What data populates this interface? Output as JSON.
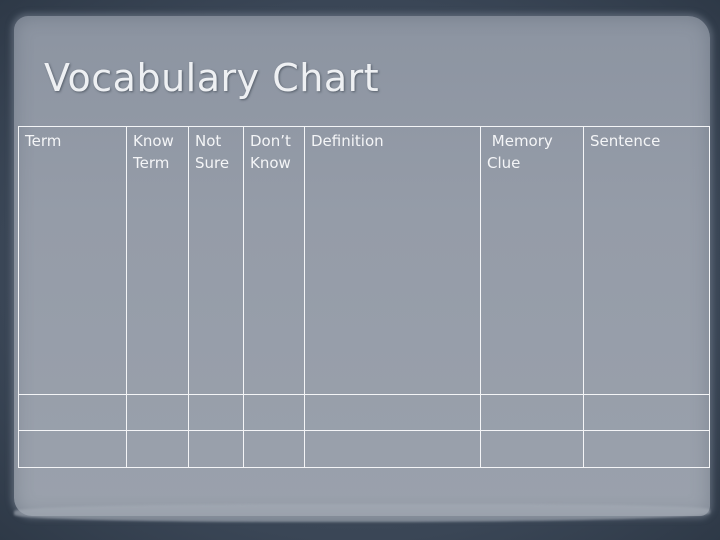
{
  "slide": {
    "title": "Vocabulary Chart"
  },
  "table": {
    "headers": [
      {
        "line1": "Term",
        "line2": ""
      },
      {
        "line1": "Know",
        "line2": "Term"
      },
      {
        "line1": "Not",
        "line2": "Sure"
      },
      {
        "line1": "Don’t",
        "line2": "Know"
      },
      {
        "line1": "Definition",
        "line2": ""
      },
      {
        "line1": " Memory",
        "line2": "Clue"
      },
      {
        "line1": "Sentence",
        "line2": ""
      }
    ],
    "rows": [
      [
        "",
        "",
        "",
        "",
        "",
        "",
        ""
      ],
      [
        "",
        "",
        "",
        "",
        "",
        "",
        ""
      ]
    ]
  }
}
